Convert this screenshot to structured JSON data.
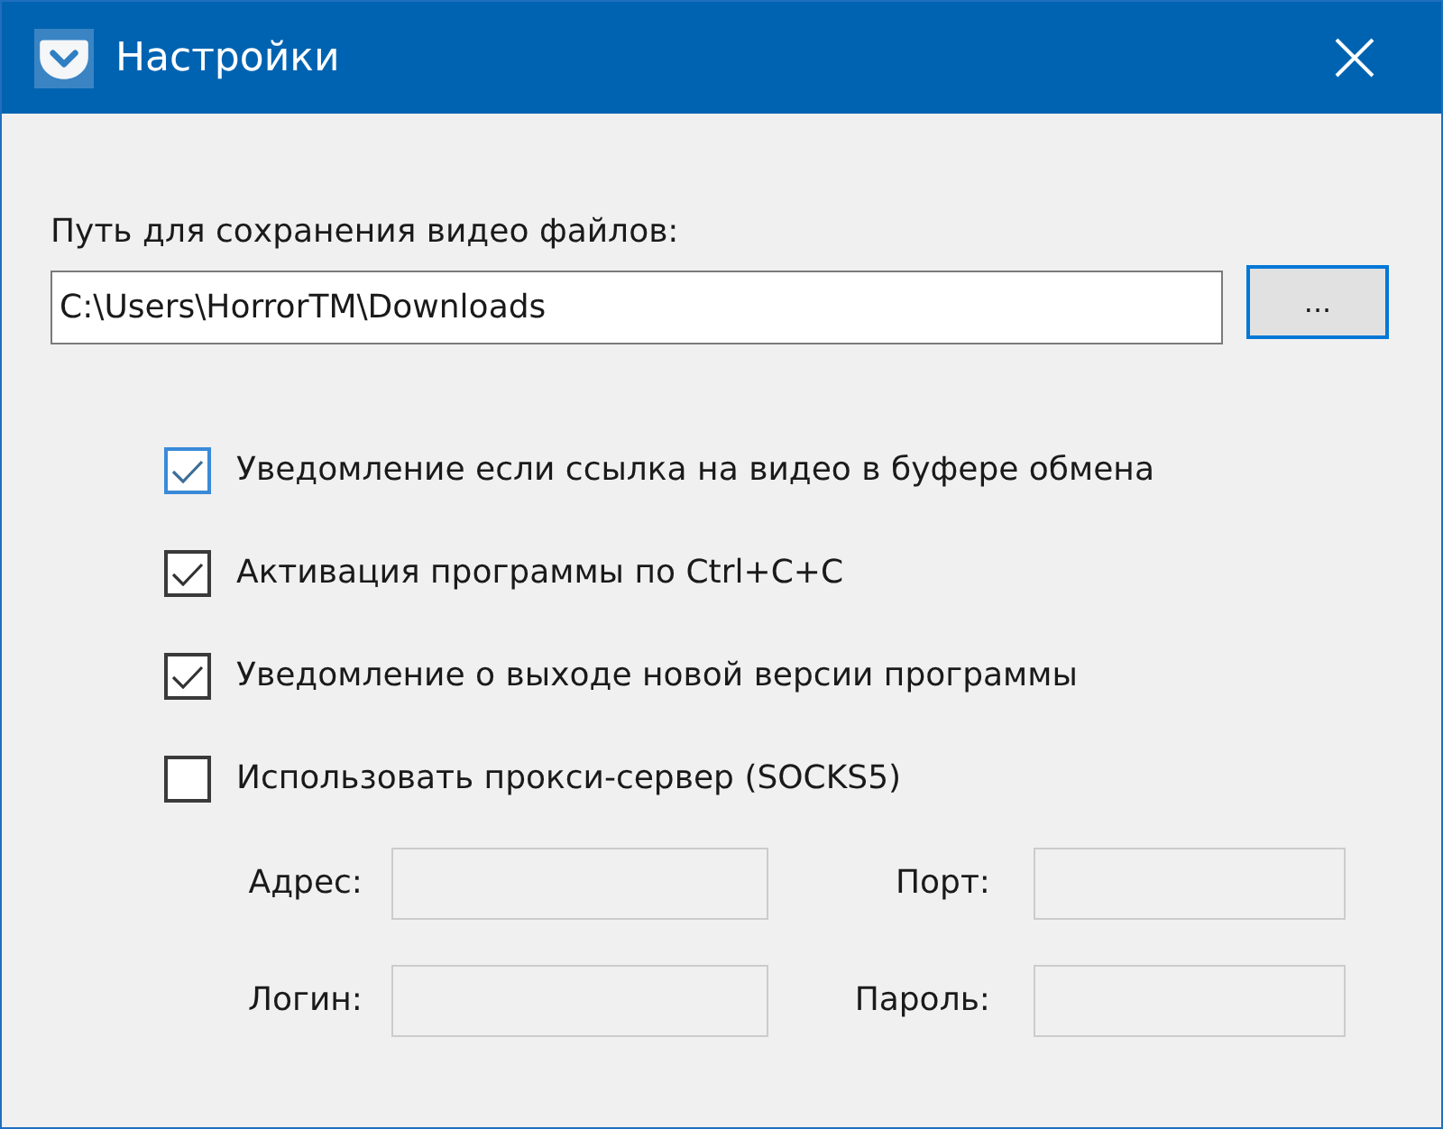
{
  "window": {
    "title": "Настройки"
  },
  "save_path": {
    "label": "Путь для сохранения видео файлов:",
    "value": "C:\\Users\\HorrorTM\\Downloads"
  },
  "browse_button": {
    "label": "...",
    "focused": true
  },
  "checkboxes": [
    {
      "label": "Уведомление если ссылка на видео в буфере обмена",
      "checked": true,
      "hovered": true
    },
    {
      "label": "Активация программы по Ctrl+C+C",
      "checked": true,
      "hovered": false
    },
    {
      "label": "Уведомление о выходе новой версии программы",
      "checked": true,
      "hovered": false
    },
    {
      "label": "Использовать прокси-сервер (SOCKS5)",
      "checked": false,
      "hovered": false
    }
  ],
  "proxy_fields": [
    {
      "label": "Адрес:",
      "disabled": true
    },
    {
      "label": "Порт:",
      "disabled": true
    },
    {
      "label": "Логин:",
      "disabled": true
    },
    {
      "label": "Пароль:",
      "disabled": true
    }
  ]
}
